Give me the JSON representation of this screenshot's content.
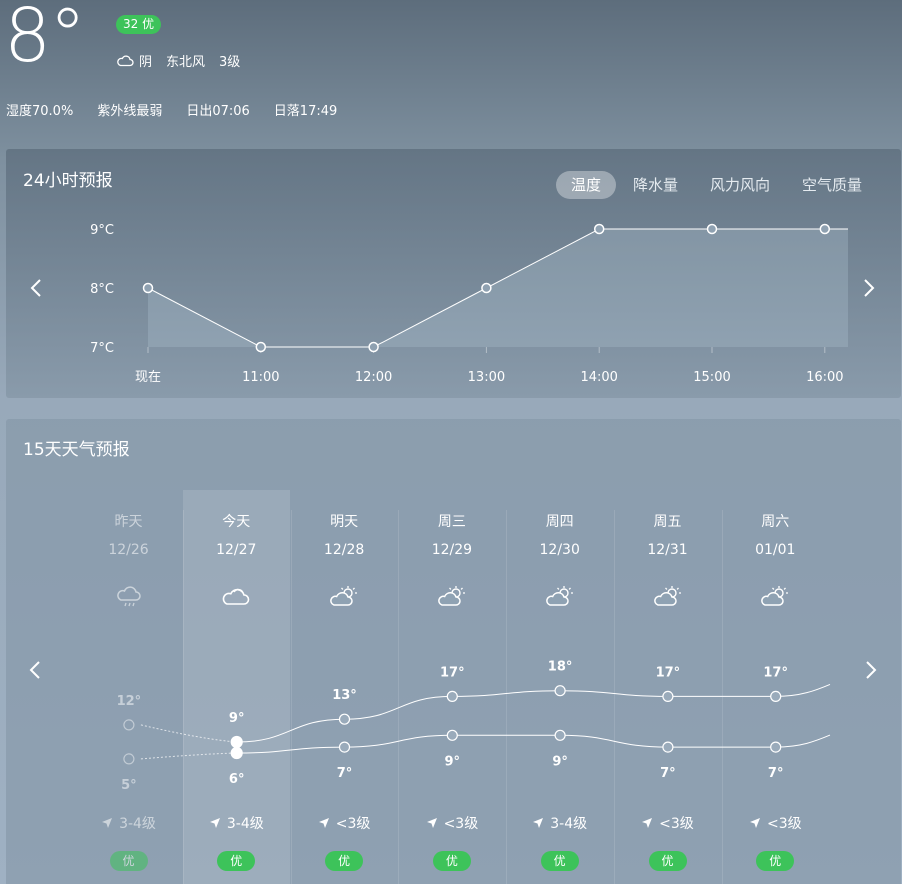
{
  "current": {
    "temp": "8°",
    "aqi_badge": "32 优",
    "condition": "阴",
    "wind_dir": "东北风",
    "wind_level": "3级",
    "humidity": "湿度70.0%",
    "uv": "紫外线最弱",
    "sunrise": "日出07:06",
    "sunset": "日落17:49"
  },
  "hourly": {
    "title": "24小时预报",
    "tabs": [
      "温度",
      "降水量",
      "风力风向",
      "空气质量"
    ],
    "active_tab": 0
  },
  "chart_data": {
    "type": "area",
    "title": "",
    "xlabel": "",
    "ylabel": "",
    "categories": [
      "现在",
      "11:00",
      "12:00",
      "13:00",
      "14:00",
      "15:00",
      "16:00"
    ],
    "values": [
      8,
      7,
      7,
      8,
      9,
      9,
      9
    ],
    "yticks": [
      "7°C",
      "8°C",
      "9°C"
    ],
    "ylim": [
      7,
      9
    ],
    "grid": false
  },
  "daily": {
    "title": "15天天气预报",
    "days": [
      {
        "name": "昨天",
        "date": "12/26",
        "icon": "rain-cloud-icon",
        "high": "12°",
        "low": "5°",
        "high_v": 12,
        "low_v": 5,
        "wind": "3-4级",
        "aqi": "优"
      },
      {
        "name": "今天",
        "date": "12/27",
        "icon": "cloudy-icon",
        "high": "9°",
        "low": "6°",
        "high_v": 9,
        "low_v": 6,
        "wind": "3-4级",
        "aqi": "优"
      },
      {
        "name": "明天",
        "date": "12/28",
        "icon": "partly-cloudy-icon",
        "high": "13°",
        "low": "7°",
        "high_v": 13,
        "low_v": 7,
        "wind": "<3级",
        "aqi": "优"
      },
      {
        "name": "周三",
        "date": "12/29",
        "icon": "partly-cloudy-icon",
        "high": "17°",
        "low": "9°",
        "high_v": 17,
        "low_v": 9,
        "wind": "<3级",
        "aqi": "优"
      },
      {
        "name": "周四",
        "date": "12/30",
        "icon": "partly-cloudy-icon",
        "high": "18°",
        "low": "9°",
        "high_v": 18,
        "low_v": 9,
        "wind": "3-4级",
        "aqi": "优"
      },
      {
        "name": "周五",
        "date": "12/31",
        "icon": "partly-cloudy-icon",
        "high": "17°",
        "low": "7°",
        "high_v": 17,
        "low_v": 7,
        "wind": "<3级",
        "aqi": "优"
      },
      {
        "name": "周六",
        "date": "01/01",
        "icon": "partly-cloudy-icon",
        "high": "17°",
        "low": "7°",
        "high_v": 17,
        "low_v": 7,
        "wind": "<3级",
        "aqi": "优"
      }
    ]
  },
  "colors": {
    "aqi_good": "#3dc35a"
  }
}
